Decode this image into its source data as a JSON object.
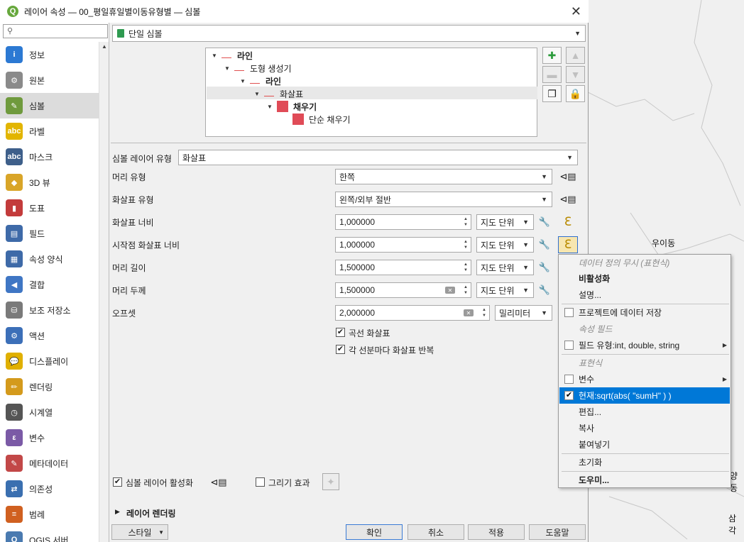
{
  "window": {
    "title": "레이어 속성 — 00_평일휴일별이동유형별 — 심볼"
  },
  "sidebar": {
    "search_placeholder": "",
    "items": [
      {
        "label": "정보",
        "icon": "info-icon",
        "color": "#2c79d3",
        "glyph": "i"
      },
      {
        "label": "원본",
        "icon": "source-wrench-icon",
        "color": "#8a8a8a",
        "glyph": "⚙"
      },
      {
        "label": "심볼",
        "icon": "symbology-brush-icon",
        "color": "#6f9a3d",
        "glyph": "✎"
      },
      {
        "label": "라벨",
        "icon": "labels-abc-icon",
        "color": "#e2b500",
        "glyph": "abc"
      },
      {
        "label": "마스크",
        "icon": "mask-abc-icon",
        "color": "#3e5f8a",
        "glyph": "abc"
      },
      {
        "label": "3D 뷰",
        "icon": "3d-view-cube-icon",
        "color": "#d9a528",
        "glyph": "◆"
      },
      {
        "label": "도표",
        "icon": "diagrams-icon",
        "color": "#c33b3b",
        "glyph": "▮"
      },
      {
        "label": "필드",
        "icon": "fields-table-icon",
        "color": "#3e6aa8",
        "glyph": "▤"
      },
      {
        "label": "속성 양식",
        "icon": "attributes-form-icon",
        "color": "#3e6aa8",
        "glyph": "▦"
      },
      {
        "label": "결합",
        "icon": "joins-icon",
        "color": "#3f76c4",
        "glyph": "◀"
      },
      {
        "label": "보조 저장소",
        "icon": "auxiliary-storage-icon",
        "color": "#7a7a7a",
        "glyph": "⛁"
      },
      {
        "label": "액션",
        "icon": "actions-gear-icon",
        "color": "#3c6fb8",
        "glyph": "⚙"
      },
      {
        "label": "디스플레이",
        "icon": "display-tooltip-icon",
        "color": "#e0b000",
        "glyph": "💬"
      },
      {
        "label": "렌더링",
        "icon": "rendering-brush-icon",
        "color": "#d49a1c",
        "glyph": "✏"
      },
      {
        "label": "시계열",
        "icon": "temporal-clock-icon",
        "color": "#555555",
        "glyph": "◷"
      },
      {
        "label": "변수",
        "icon": "variables-epsilon-icon",
        "color": "#7b5aa6",
        "glyph": "ε"
      },
      {
        "label": "메타데이터",
        "icon": "metadata-icon",
        "color": "#c24848",
        "glyph": "✎"
      },
      {
        "label": "의존성",
        "icon": "dependencies-icon",
        "color": "#3a6fb0",
        "glyph": "⇄"
      },
      {
        "label": "범례",
        "icon": "legend-icon",
        "color": "#d06020",
        "glyph": "≡"
      },
      {
        "label": "QGIS 서버",
        "icon": "qgis-server-icon",
        "color": "#4a7ab0",
        "glyph": "Q"
      }
    ],
    "active_index": 2
  },
  "symbol_type": "단일 심볼",
  "tree": [
    {
      "label": "라인",
      "swatch": "line",
      "bold": true,
      "expanded": true
    },
    {
      "label": "도형 생성기",
      "swatch": "line",
      "bold": false,
      "expanded": true
    },
    {
      "label": "라인",
      "swatch": "line",
      "bold": true,
      "expanded": true
    },
    {
      "label": "화살표",
      "swatch": "line",
      "bold": false,
      "expanded": true
    },
    {
      "label": "채우기",
      "swatch": "fill",
      "bold": true,
      "expanded": true
    },
    {
      "label": "단순 채우기",
      "swatch": "fill",
      "bold": false,
      "expanded": false
    }
  ],
  "layer_type": {
    "label": "심볼 레이어 유형",
    "value": "화살표"
  },
  "props": {
    "head_type": {
      "label": "머리 유형",
      "value": "한쪽"
    },
    "arrow_type": {
      "label": "화살표 유형",
      "value": "왼쪽/외부 절반"
    },
    "arrow_width": {
      "label": "화살표 너비",
      "value": "1,000000",
      "unit": "지도 단위"
    },
    "start_width": {
      "label": "시작점 화살표 너비",
      "value": "1,000000",
      "unit": "지도 단위"
    },
    "head_length": {
      "label": "머리 길이",
      "value": "1,500000",
      "unit": "지도 단위"
    },
    "head_thickness": {
      "label": "머리 두께",
      "value": "1,500000",
      "unit": "지도 단위"
    },
    "offset": {
      "label": "오프셋",
      "value": "2,000000",
      "unit": "밀리미터"
    },
    "curved": {
      "label": "곡선 화살표",
      "checked": true
    },
    "repeat": {
      "label": "각 선분마다 화살표 반복",
      "checked": true
    }
  },
  "footer": {
    "enable_layer": {
      "label": "심볼 레이어 활성화",
      "checked": true
    },
    "draw_effects": {
      "label": "그리기 효과",
      "checked": false
    },
    "layer_rendering": "레이어 렌더링",
    "style": "스타일",
    "ok": "확인",
    "cancel": "취소",
    "apply": "적용",
    "help": "도움말"
  },
  "map_labels": {
    "a": "우이동",
    "b": "양동",
    "c": "삼각"
  },
  "context_menu": {
    "header": "데이터 정의 무시 (표현식)",
    "deactivate": "비활성화",
    "description": "설명...",
    "store_data": "프로젝트에 데이터 저장",
    "attr_field_section": "속성 필드",
    "field_type": "필드 유형:int, double, string",
    "expression_section": "표현식",
    "variable": "변수",
    "current": "현재:sqrt(abs( \"sumH\" ) )",
    "edit": "편집...",
    "copy": "복사",
    "paste": "붙여넣기",
    "clear": "초기화",
    "assistant": "도우미..."
  }
}
